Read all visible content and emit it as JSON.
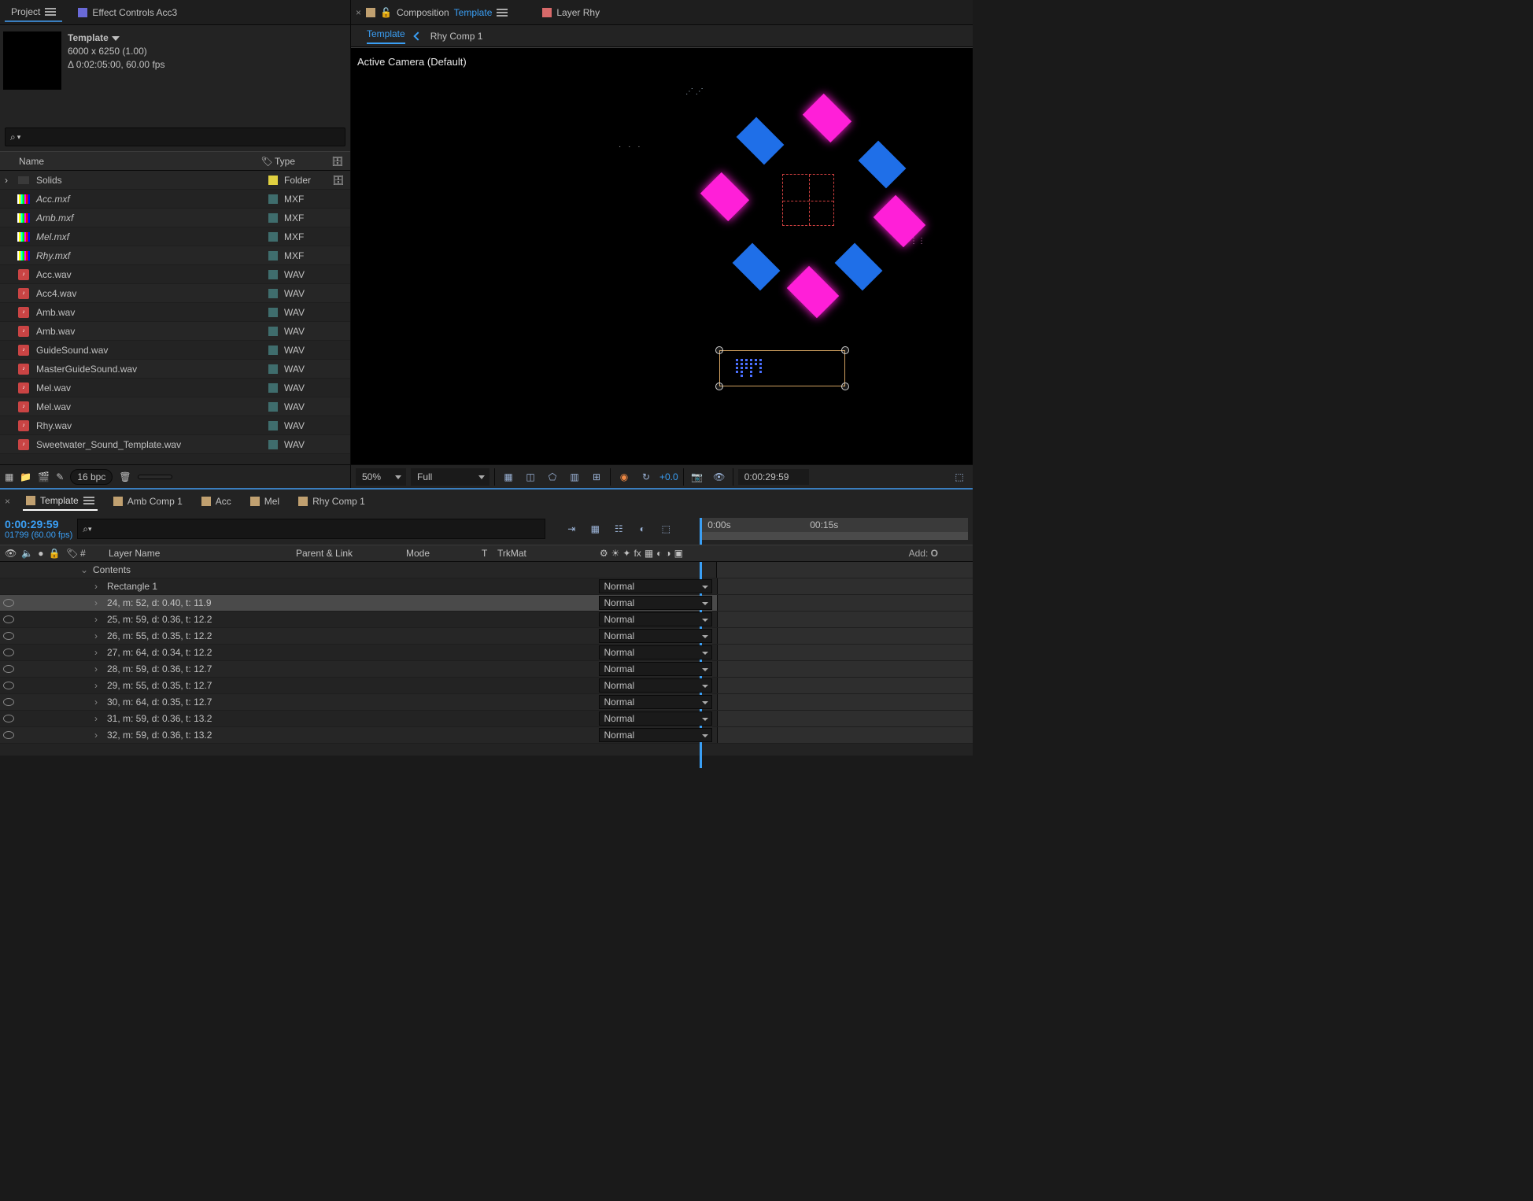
{
  "project_tab": "Project",
  "effects_tab": "Effect Controls Acc3",
  "comp_name": "Template",
  "comp_dim": "6000 x 6250 (1.00)",
  "comp_dur": "Δ 0:02:05:00, 60.00 fps",
  "hdr_name": "Name",
  "hdr_type": "Type",
  "assets": [
    {
      "name": "Solids",
      "type": "Folder",
      "item_type": "folder",
      "italic": false,
      "color": "#e0d040"
    },
    {
      "name": "Acc.mxf",
      "type": "MXF",
      "item_type": "mxf",
      "italic": true,
      "color": "#3f6d6d"
    },
    {
      "name": "Amb.mxf",
      "type": "MXF",
      "item_type": "mxf",
      "italic": true,
      "color": "#3f6d6d"
    },
    {
      "name": "Mel.mxf",
      "type": "MXF",
      "item_type": "mxf",
      "italic": true,
      "color": "#3f6d6d"
    },
    {
      "name": "Rhy.mxf",
      "type": "MXF",
      "item_type": "mxf",
      "italic": true,
      "color": "#3f6d6d"
    },
    {
      "name": "Acc.wav",
      "type": "WAV",
      "item_type": "wav",
      "italic": false,
      "color": "#3f6d6d"
    },
    {
      "name": "Acc4.wav",
      "type": "WAV",
      "item_type": "wav",
      "italic": false,
      "color": "#3f6d6d"
    },
    {
      "name": "Amb.wav",
      "type": "WAV",
      "item_type": "wav",
      "italic": false,
      "color": "#3f6d6d"
    },
    {
      "name": "Amb.wav",
      "type": "WAV",
      "item_type": "wav",
      "italic": false,
      "color": "#3f6d6d"
    },
    {
      "name": "GuideSound.wav",
      "type": "WAV",
      "item_type": "wav",
      "italic": false,
      "color": "#3f6d6d"
    },
    {
      "name": "MasterGuideSound.wav",
      "type": "WAV",
      "item_type": "wav",
      "italic": false,
      "color": "#3f6d6d"
    },
    {
      "name": "Mel.wav",
      "type": "WAV",
      "item_type": "wav",
      "italic": false,
      "color": "#3f6d6d"
    },
    {
      "name": "Mel.wav",
      "type": "WAV",
      "item_type": "wav",
      "italic": false,
      "color": "#3f6d6d"
    },
    {
      "name": "Rhy.wav",
      "type": "WAV",
      "item_type": "wav",
      "italic": false,
      "color": "#3f6d6d"
    },
    {
      "name": "Sweetwater_Sound_Template.wav",
      "type": "WAV",
      "item_type": "wav",
      "italic": false,
      "color": "#3f6d6d"
    }
  ],
  "bpc": "16 bpc",
  "comp_panel_title": "Composition",
  "comp_panel_comp": "Template",
  "layer_panel_title": "Layer Rhy",
  "breadcrumbs": [
    "Template",
    "Rhy Comp 1"
  ],
  "camera_label": "Active Camera (Default)",
  "zoom": "50%",
  "quality": "Full",
  "exposure": "+0.0",
  "viewer_tc": "0:00:29:59",
  "tl_tabs": [
    "Template",
    "Amb Comp 1",
    "Acc",
    "Mel",
    "Rhy Comp 1"
  ],
  "tl_tc": "0:00:29:59",
  "tl_fps": "01799 (60.00 fps)",
  "ruler": [
    "0:00s",
    "00:15s"
  ],
  "cols": {
    "num": "#",
    "layer": "Layer Name",
    "parent": "Parent & Link",
    "mode": "Mode",
    "t": "T",
    "trk": "TrkMat"
  },
  "add": "Add:",
  "contents": "Contents",
  "rect": "Rectangle 1",
  "tracks": [
    {
      "label": "24, m: 52, d: 0.40, t: 11.9",
      "mode": "Normal",
      "sel": true
    },
    {
      "label": "25, m: 59, d: 0.36, t: 12.2",
      "mode": "Normal",
      "sel": false
    },
    {
      "label": "26, m: 55, d: 0.35, t: 12.2",
      "mode": "Normal",
      "sel": false
    },
    {
      "label": "27, m: 64, d: 0.34, t: 12.2",
      "mode": "Normal",
      "sel": false
    },
    {
      "label": "28, m: 59, d: 0.36, t: 12.7",
      "mode": "Normal",
      "sel": false
    },
    {
      "label": "29, m: 55, d: 0.35, t: 12.7",
      "mode": "Normal",
      "sel": false
    },
    {
      "label": "30, m: 64, d: 0.35, t: 12.7",
      "mode": "Normal",
      "sel": false
    },
    {
      "label": "31, m: 59, d: 0.36, t: 13.2",
      "mode": "Normal",
      "sel": false
    },
    {
      "label": "32, m: 59, d: 0.36, t: 13.2",
      "mode": "Normal",
      "sel": false
    }
  ]
}
